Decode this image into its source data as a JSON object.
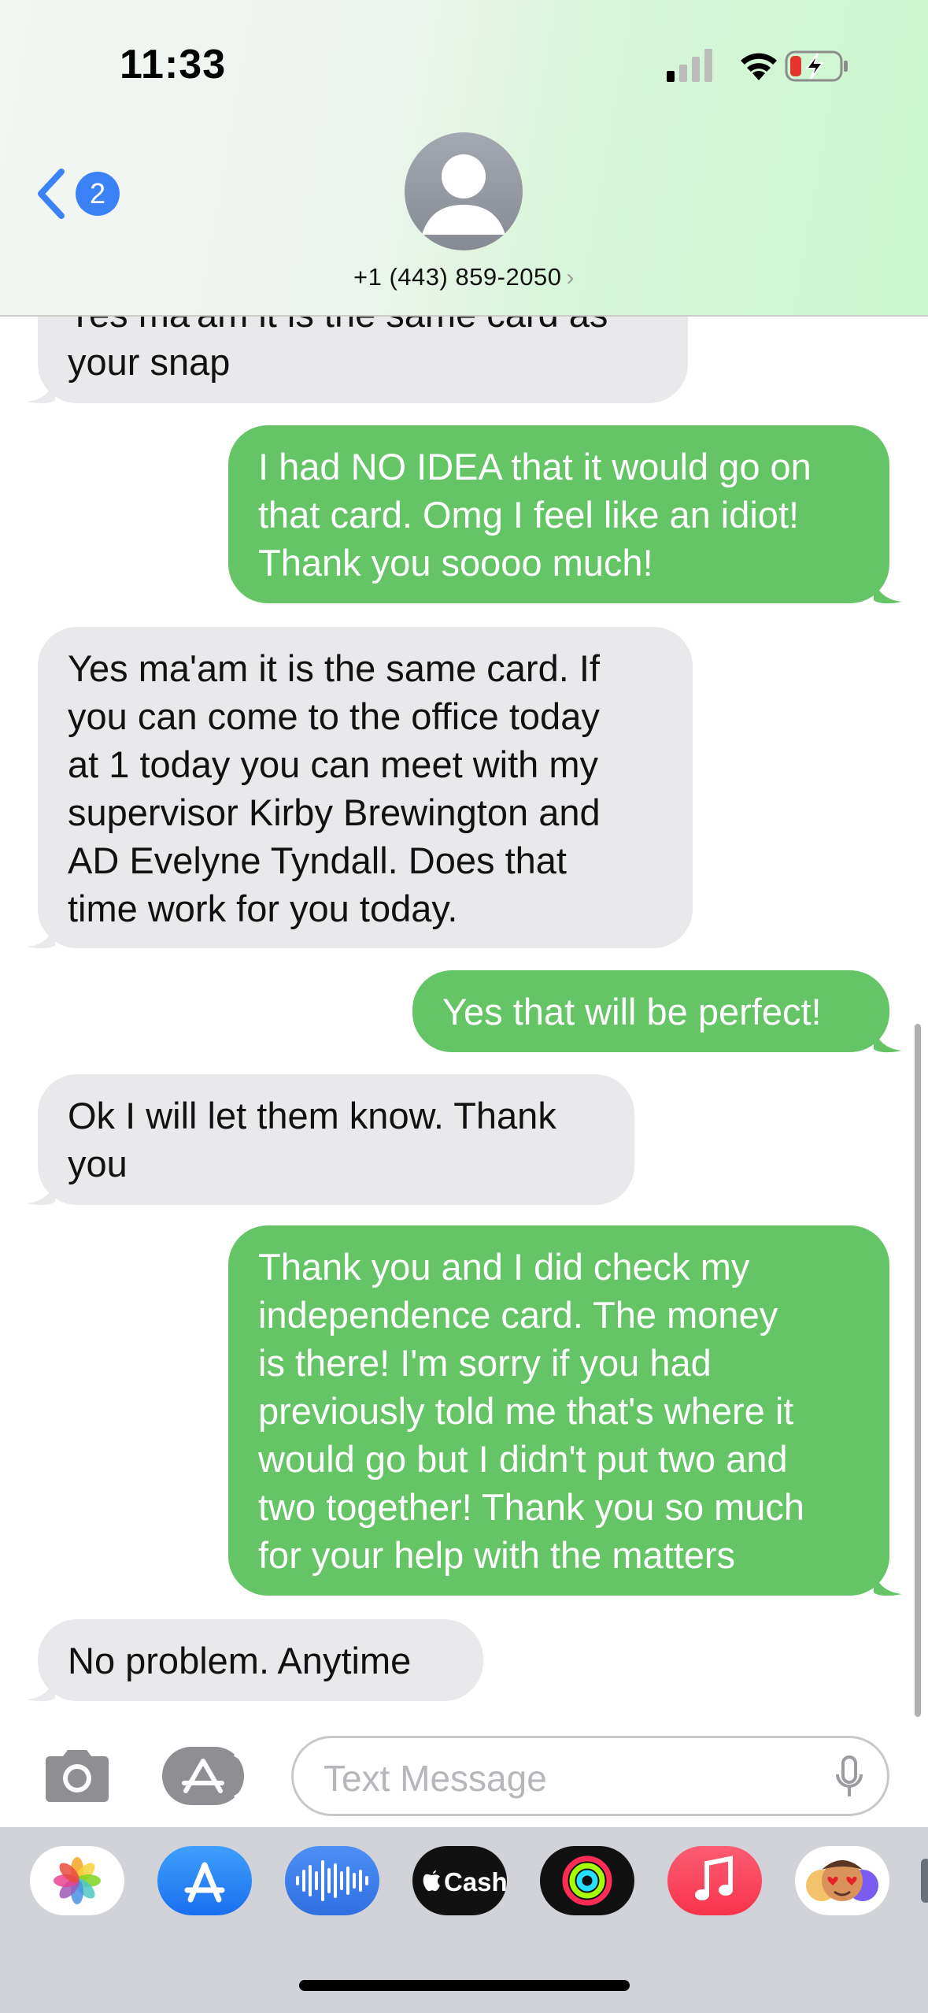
{
  "status_bar": {
    "time": "11:33"
  },
  "nav": {
    "back_count": "2",
    "contact": "+1 (443) 859-2050",
    "chevron": "›"
  },
  "messages": [
    {
      "type": "received",
      "lines": [
        "Yes ma'am it is the same card as",
        "your snap"
      ]
    },
    {
      "type": "sent",
      "lines": [
        "I had NO IDEA that it would go on",
        "that card. Omg I feel like an idiot!",
        "Thank you soooo much!"
      ]
    },
    {
      "type": "received",
      "lines": [
        "Yes ma'am it is the same card. If",
        "you can come to the office today",
        "at 1 today you can meet with my",
        "supervisor Kirby Brewington and",
        "AD Evelyne Tyndall. Does that",
        "time work for you today."
      ]
    },
    {
      "type": "sent",
      "lines": [
        "Yes that will be perfect!"
      ]
    },
    {
      "type": "received",
      "lines": [
        "Ok I will let them know. Thank",
        "you"
      ]
    },
    {
      "type": "sent",
      "lines": [
        "Thank you and I did check my",
        "independence card. The money",
        "is there! I'm sorry if you had",
        "previously told me that's where it",
        "would go but I didn't put two and",
        "two together! Thank you so much",
        "for your help with the matters"
      ]
    },
    {
      "type": "received",
      "lines": [
        "No problem. Anytime"
      ]
    }
  ],
  "compose": {
    "placeholder": "Text Message"
  },
  "app_drawer": [
    {
      "name": "photos-app",
      "label": ""
    },
    {
      "name": "app-store-app",
      "label": ""
    },
    {
      "name": "audio-message-app",
      "label": ""
    },
    {
      "name": "apple-cash-app",
      "label": "Cash"
    },
    {
      "name": "activity-app",
      "label": ""
    },
    {
      "name": "music-app",
      "label": ""
    },
    {
      "name": "memoji-app",
      "label": ""
    }
  ],
  "colors": {
    "sent_bubble": "#65c466",
    "received_bubble": "#e9e9eb",
    "accent": "#3b82f6"
  }
}
